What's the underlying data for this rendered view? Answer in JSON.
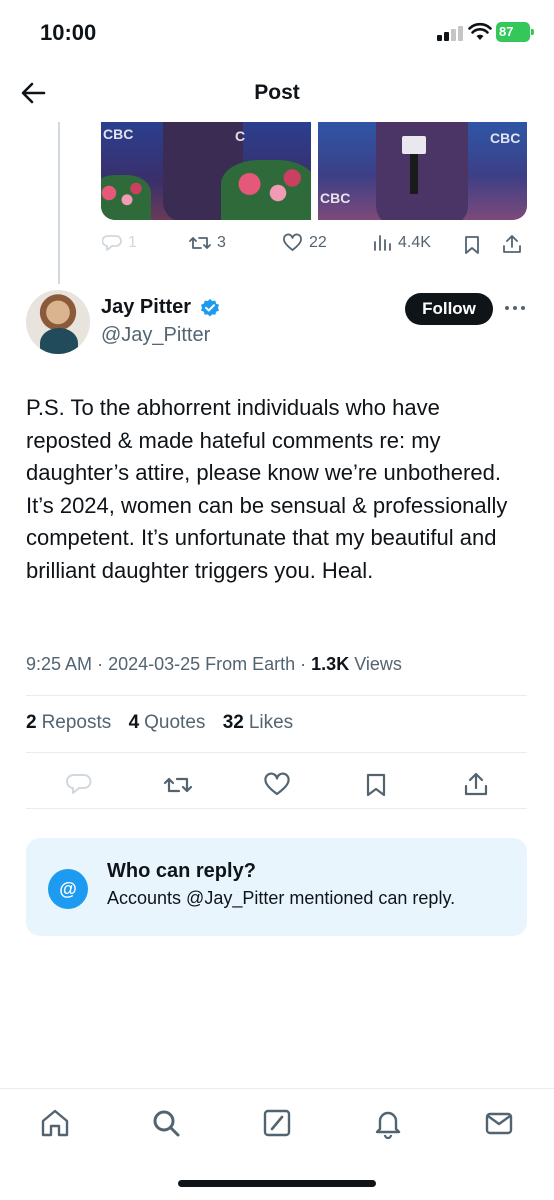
{
  "status_bar": {
    "time": "10:00",
    "battery": "87"
  },
  "header": {
    "title": "Post"
  },
  "previous_post": {
    "media_watermarks": [
      "CBC",
      "CBC",
      "CBC",
      "CBC"
    ],
    "actions": {
      "replies": "1",
      "reposts": "3",
      "likes": "22",
      "views": "4.4K"
    }
  },
  "post": {
    "author_name": "Jay Pitter",
    "author_handle": "@Jay_Pitter",
    "follow_label": "Follow",
    "text": "P.S. To the abhorrent individuals who have reposted & made hateful comments re: my daughter’s attire, please know we’re unbothered. It’s 2024, women can be sensual & professionally competent. It’s unfortunate that my beautiful and brilliant daughter triggers you. Heal.",
    "time": "9:25 AM",
    "date": "2024-03-25 From Earth",
    "views_count": "1.3K",
    "views_label": "Views",
    "reposts_count": "2",
    "reposts_label": "Reposts",
    "quotes_count": "4",
    "quotes_label": "Quotes",
    "likes_count": "32",
    "likes_label": "Likes"
  },
  "reply_notice": {
    "icon": "@",
    "title": "Who can reply?",
    "subtitle": "Accounts @Jay_Pitter mentioned can reply."
  },
  "colors": {
    "accent": "#1d9bf0",
    "text": "#0f1419",
    "secondary": "#536471",
    "battery": "#34c759"
  },
  "nav": [
    "home-icon",
    "search-icon",
    "grok-icon",
    "notifications-icon",
    "messages-icon"
  ]
}
